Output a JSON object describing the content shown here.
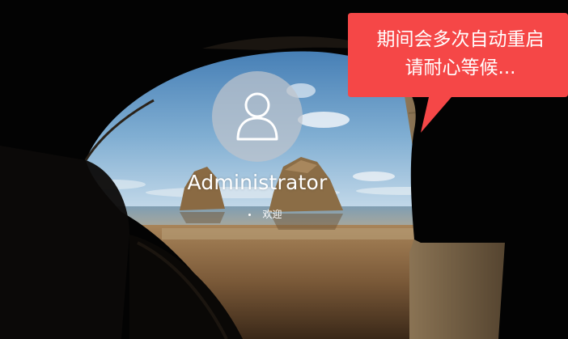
{
  "login": {
    "username": "Administrator",
    "status_text": "欢迎"
  },
  "callout": {
    "line1": "期间会多次自动重启",
    "line2": "请耐心等候..."
  },
  "icons": {
    "avatar": "user-icon",
    "spinner": "loading-spinner-icon"
  },
  "colors": {
    "callout_bg": "#F54747",
    "avatar_circle": "#BEC4CC",
    "text": "#FFFFFF"
  }
}
